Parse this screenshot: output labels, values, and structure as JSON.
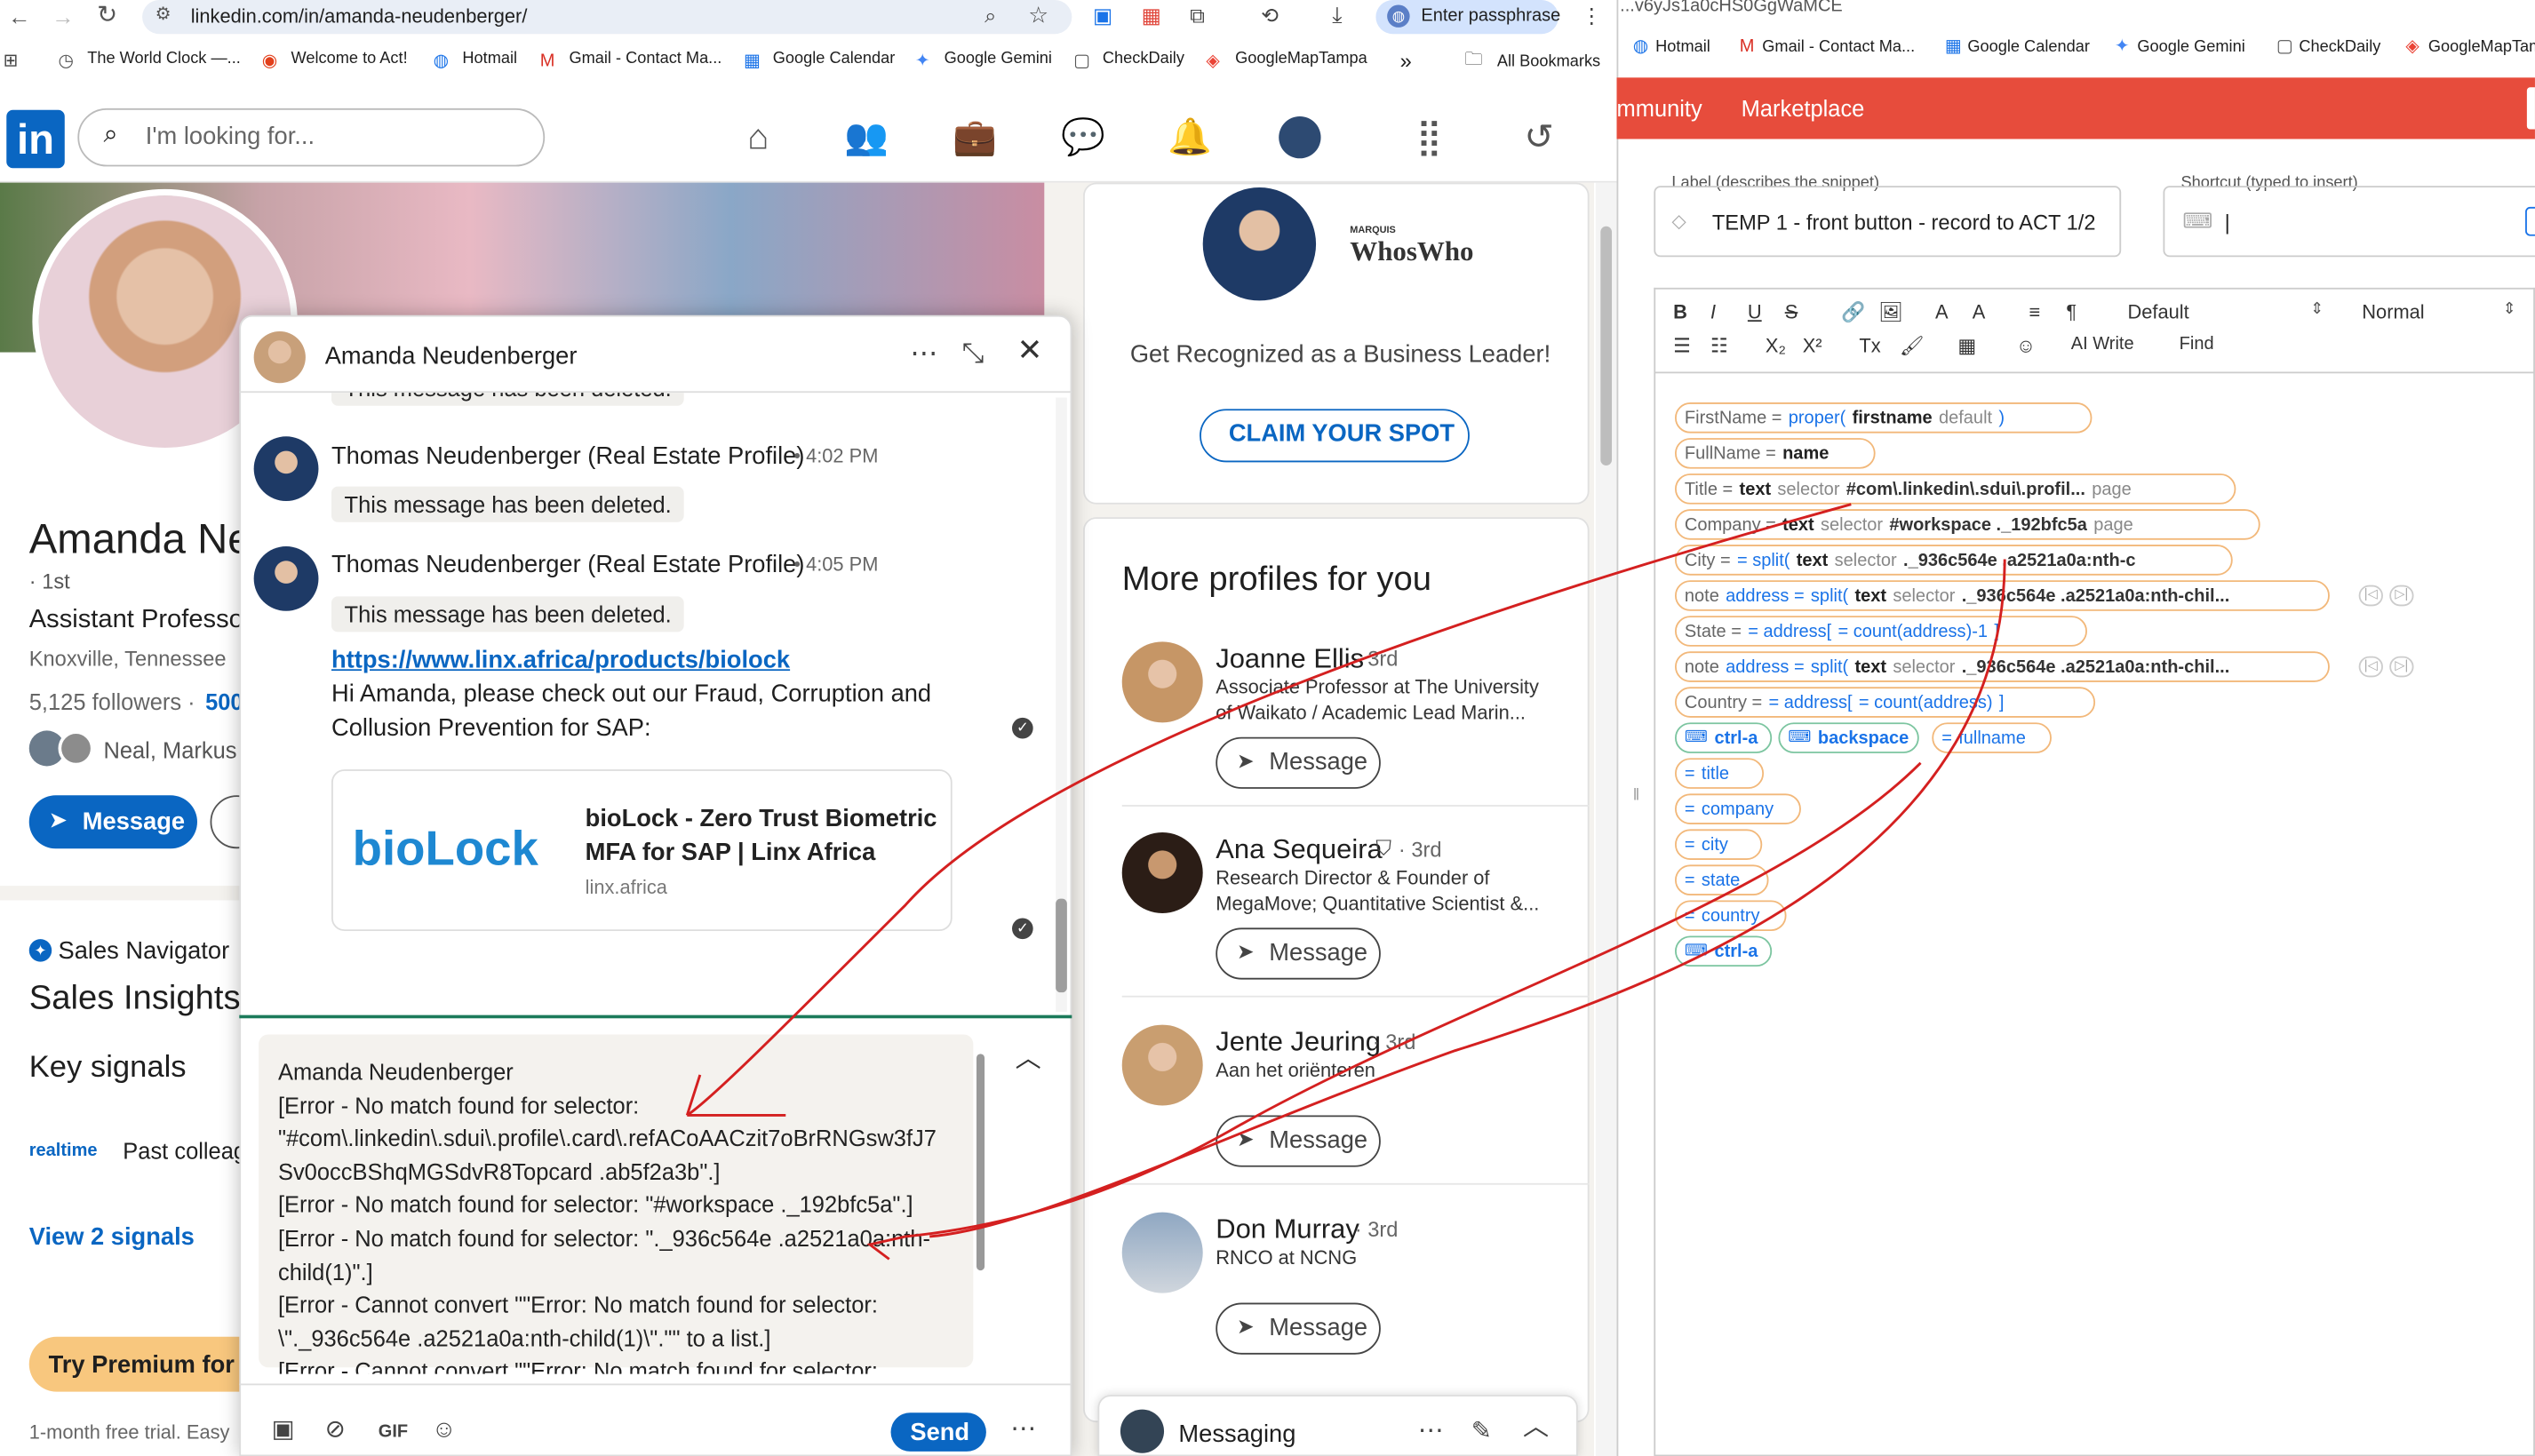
{
  "browser": {
    "url": "linkedin.com/in/amanda-neudenberger/",
    "passphrase": "Enter passphrase",
    "right_url": "...v6yJs1a0cHS0GgWaMCE"
  },
  "bookmarks": [
    "The World Clock —...",
    "Welcome to Act!",
    "Hotmail",
    "Gmail - Contact Ma...",
    "Google Calendar",
    "Google Gemini",
    "CheckDaily",
    "GoogleMapTampa"
  ],
  "bookmarks_more": "»",
  "all_bookmarks": "All Bookmarks",
  "right_bookmarks": [
    "Hotmail",
    "Gmail - Contact Ma...",
    "Google Calendar",
    "Google Gemini",
    "CheckDaily",
    "GoogleMapTampa"
  ],
  "linkedin": {
    "logo": "in",
    "search_placeholder": "I'm looking for...",
    "profile": {
      "name": "Amanda Ne",
      "degree": "· 1st",
      "headline": "Assistant Professo",
      "location": "Knoxville, Tennessee",
      "followers": "5,125 followers ·",
      "connections": "500",
      "mutual": "Neal, Markus",
      "message_btn": "Message"
    },
    "sales": {
      "nav": "Sales Navigator",
      "title": "Sales Insights",
      "key_signals": "Key signals",
      "realtime": "realtime",
      "past": "Past colleag",
      "view": "View 2 signals",
      "premium": "Try Premium for $",
      "trial": "1-month free trial. Easy"
    },
    "ad": {
      "brand": "WhosWho",
      "brand_small": "MARQUIS",
      "text": "Get Recognized as a Business Leader!",
      "cta": "CLAIM YOUR SPOT"
    },
    "more": {
      "title": "More profiles for you",
      "message": "Message",
      "profiles": [
        {
          "name": "Joanne Ellis",
          "deg": "· 3rd",
          "line1": "Associate Professor at The University",
          "line2": "of Waikato  / Academic Lead Marin..."
        },
        {
          "name": "Ana Sequeira",
          "deg": "· 3rd",
          "line1": "Research Director & Founder of",
          "line2": "MegaMove; Quantitative Scientist &..."
        },
        {
          "name": "Jente Jeuring",
          "deg": "· 3rd",
          "line1": "Aan het oriënteren",
          "line2": ""
        },
        {
          "name": "Don Murray",
          "deg": "· 3rd",
          "line1": "RNCO at NCNG",
          "line2": ""
        }
      ]
    },
    "messaging_bar": "Messaging"
  },
  "chat": {
    "name": "Amanda Neudenberger",
    "deleted_top": "This message has been deleted.",
    "msgs": [
      {
        "sender": "Thomas Neudenberger (Real Estate Profile)",
        "time": "• 4:02 PM",
        "text": "This message has been deleted."
      },
      {
        "sender": "Thomas Neudenberger (Real Estate Profile)",
        "time": "• 4:05 PM",
        "text": "This message has been deleted."
      }
    ],
    "link": "https://www.linx.africa/products/biolock",
    "body1": "Hi Amanda, please check out our Fraud, Corruption and",
    "body2": "Collusion Prevention for SAP:",
    "preview": {
      "logo": "bioLock",
      "title1": "bioLock - Zero Trust Biometric",
      "title2": "MFA for SAP | Linx Africa",
      "domain": "linx.africa"
    },
    "compose": [
      "Amanda Neudenberger",
      "[Error - No match found for selector:",
      "\"#com\\.linkedin\\.sdui\\.profile\\.card\\.refACoAACzit7oBrRNGsw3fJ7",
      "Sv0occBShqMGSdvR8Topcard .ab5f2a3b\".]",
      "[Error - No match found for selector: \"#workspace ._192bfc5a\".]",
      "[Error - No match found for selector: \"._936c564e .a2521a0a:nth-",
      "child(1)\".]",
      "[Error - Cannot convert \"\"Error: No match found for selector:",
      "\\\"._936c564e .a2521a0a:nth-child(1)\\\".\"\" to a list.]",
      "[Error - Cannot convert \"\"Error: No match found for selector:"
    ],
    "send": "Send"
  },
  "editor": {
    "tabs": [
      "mmunity",
      "Marketplace"
    ],
    "label_caption": "Label (describes the snippet)",
    "label_value": "TEMP 1 - front button - record to ACT 1/2",
    "shortcut_caption": "Shortcut (typed to insert)",
    "shortcut_value": "|",
    "toolbar1": [
      "B",
      "I",
      "U",
      "S",
      "🔗",
      "🖼",
      "A",
      "A",
      "≡",
      "¶",
      "Default",
      "Normal"
    ],
    "toolbar2": [
      "☰",
      "☷",
      "X₂",
      "X²",
      "Tx",
      "🖌",
      "▦",
      "☺",
      "AI Write",
      "Find"
    ],
    "rows": [
      {
        "label": "FirstName =",
        "parts": [
          "proper(",
          "firstname",
          "default",
          ")"
        ]
      },
      {
        "label": "FullName =",
        "parts": [
          "name"
        ]
      },
      {
        "label": "Title =",
        "parts": [
          "text",
          "selector",
          "#com\\.linkedin\\.sdui\\.profil...",
          "page"
        ]
      },
      {
        "label": "Company =",
        "parts": [
          "text",
          "selector",
          "#workspace ._192bfc5a",
          "page"
        ]
      },
      {
        "label": "City =",
        "parts": [
          "= split(",
          "text",
          "selector",
          "._936c564e .a2521a0a:nth-c"
        ]
      },
      {
        "label": "note",
        "parts": [
          "address =",
          "split(",
          "text",
          "selector",
          "._936c564e .a2521a0a:nth-chil..."
        ]
      },
      {
        "label": "State =",
        "parts": [
          "= address[",
          "= count(address)-1",
          "]"
        ]
      },
      {
        "label": "note",
        "parts": [
          "address =",
          "split(",
          "text",
          "selector",
          "._936c564e .a2521a0a:nth-chil..."
        ]
      },
      {
        "label": "Country =",
        "parts": [
          "= address[",
          "= count(address)",
          "]"
        ]
      }
    ],
    "keys": [
      "ctrl-a",
      "backspace",
      "fullname",
      "title",
      "company",
      "city",
      "state",
      "country",
      "ctrl-a"
    ]
  }
}
